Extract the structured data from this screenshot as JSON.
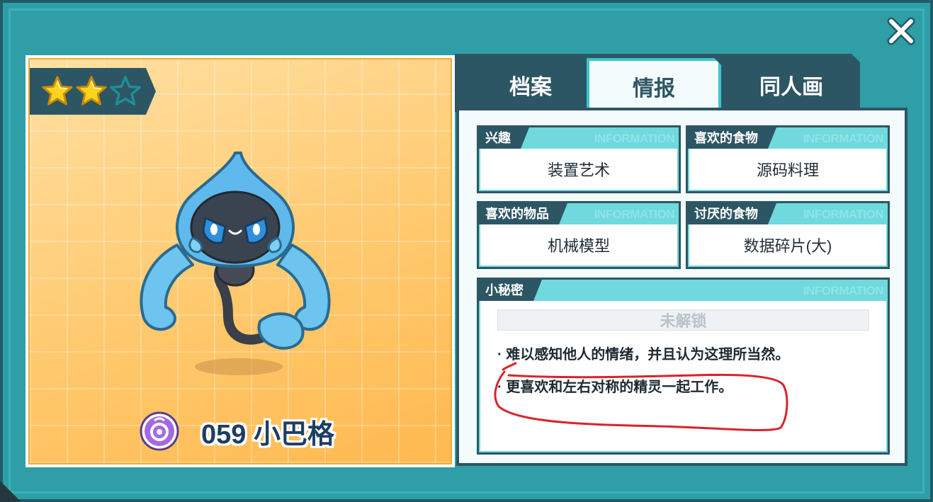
{
  "rank": {
    "stars_filled": 2,
    "stars_total": 3
  },
  "pet": {
    "number_name": "059 小巴格"
  },
  "tabs": [
    {
      "label": "档案",
      "active": false
    },
    {
      "label": "情报",
      "active": true
    },
    {
      "label": "同人画",
      "active": false
    }
  ],
  "cards": {
    "interest": {
      "label": "兴趣",
      "value": "装置艺术",
      "watermark": "INFORMATION"
    },
    "liked_food": {
      "label": "喜欢的食物",
      "value": "源码料理",
      "watermark": "INFORMATION"
    },
    "liked_item": {
      "label": "喜欢的物品",
      "value": "机械模型",
      "watermark": "INFORMATION"
    },
    "disliked_food": {
      "label": "讨厌的食物",
      "value": "数据碎片(大)",
      "watermark": "INFORMATION"
    }
  },
  "secret": {
    "label": "小秘密",
    "watermark": "INFORMATION",
    "locked_text": "未解锁",
    "lines": [
      "· 难以感知他人的情绪，并且认为这理所当然。",
      "· 更喜欢和左右对称的精灵一起工作。"
    ]
  },
  "colors": {
    "frame": "#2f9ea6",
    "dark": "#2d5664",
    "accent": "#6fd9dd",
    "annotation": "#d9232b"
  },
  "icons": {
    "close": "close-icon",
    "star": "star-icon",
    "element": "element-type-icon"
  }
}
